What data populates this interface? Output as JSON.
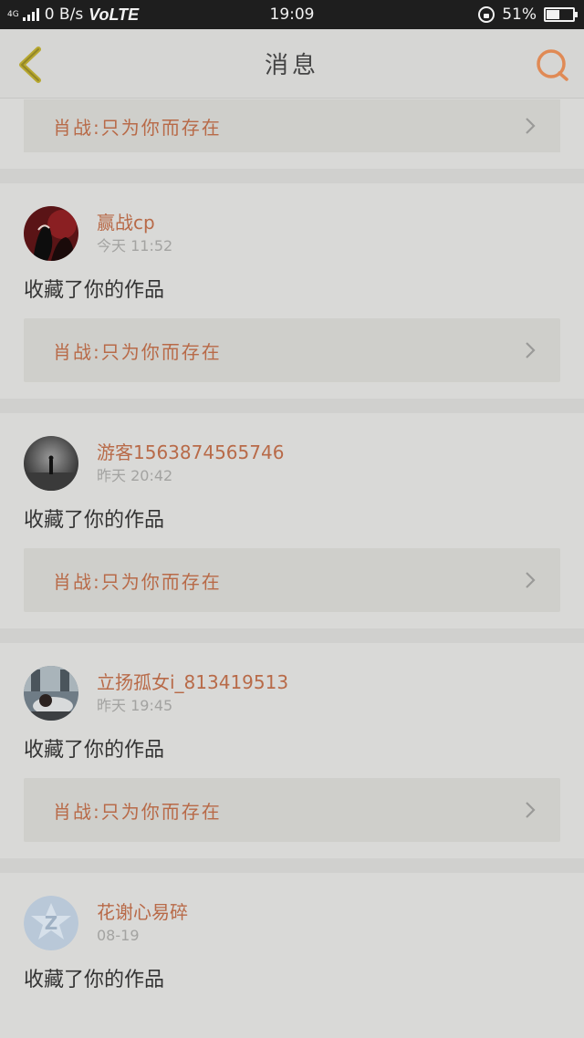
{
  "status_bar": {
    "network_type": "4G",
    "speed": "0 B/s",
    "volte": "VoLTE",
    "time": "19:09",
    "battery": "51%",
    "battery_level": 0.51
  },
  "header": {
    "title": "消息",
    "back_icon": "chevron-left-icon",
    "search_icon": "search-icon"
  },
  "colors": {
    "accent": "#b86a48",
    "back_icon": "#b8a830",
    "search_icon": "#e08a55",
    "background": "#d9d9d7"
  },
  "top_partial": {
    "work_title": "肖战:只为你而存在"
  },
  "notifications": [
    {
      "username": "赢战cp",
      "timestamp": "今天 11:52",
      "action": "收藏了你的作品",
      "work_title": "肖战:只为你而存在"
    },
    {
      "username": "游客1563874565746",
      "timestamp": "昨天 20:42",
      "action": "收藏了你的作品",
      "work_title": "肖战:只为你而存在"
    },
    {
      "username": "立扬孤女i_813419513",
      "timestamp": "昨天 19:45",
      "action": "收藏了你的作品",
      "work_title": "肖战:只为你而存在"
    },
    {
      "username": "花谢心易碎",
      "timestamp": "08-19",
      "action": "收藏了你的作品"
    }
  ]
}
